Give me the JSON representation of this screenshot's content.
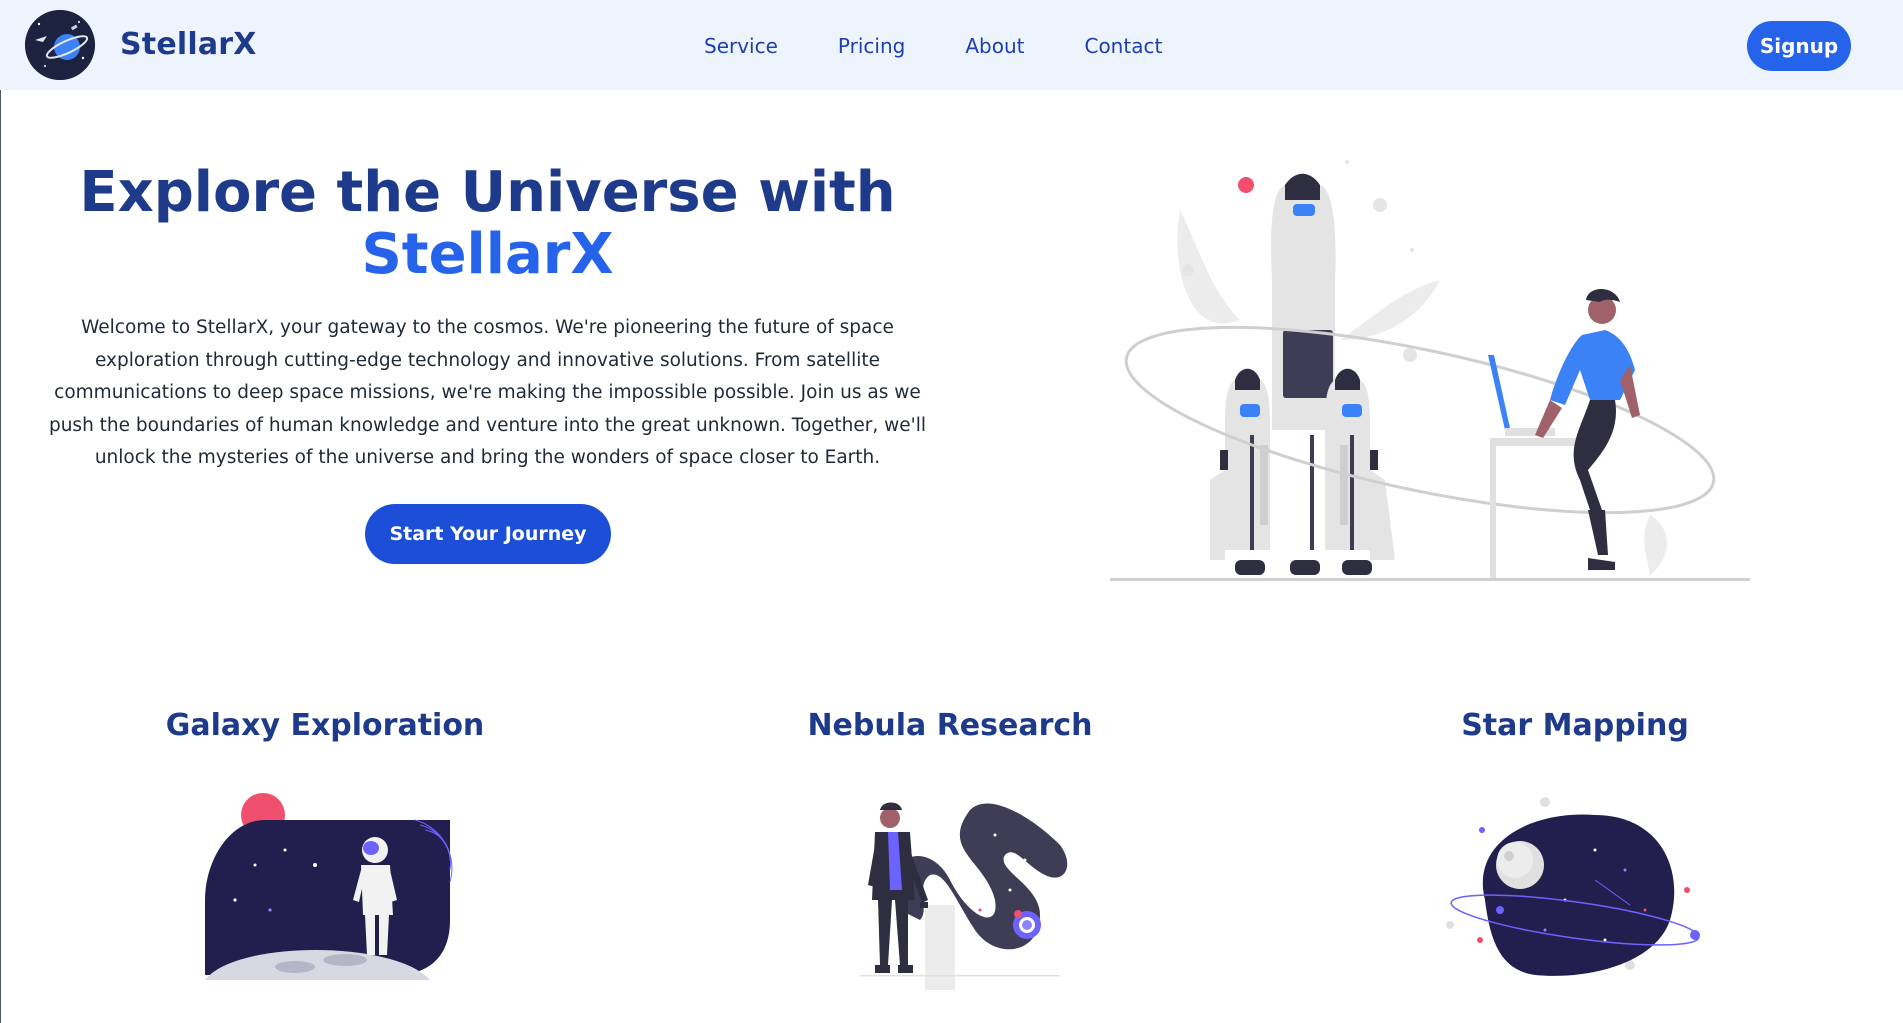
{
  "header": {
    "brand": "StellarX",
    "nav": [
      {
        "label": "Service"
      },
      {
        "label": "Pricing"
      },
      {
        "label": "About"
      },
      {
        "label": "Contact"
      }
    ],
    "signup_label": "Signup"
  },
  "hero": {
    "title_line1": "Explore the Universe with",
    "title_line2": "StellarX",
    "text": "Welcome to StellarX, your gateway to the cosmos. We're pioneering the future of space exploration through cutting-edge technology and innovative solutions. From satellite communications to deep space missions, we're making the impossible possible. Join us as we push the boundaries of human knowledge and venture into the great unknown. Together, we'll unlock the mysteries of the universe and bring the wonders of space closer to Earth.",
    "cta_label": "Start Your Journey"
  },
  "features": [
    {
      "title": "Galaxy Exploration"
    },
    {
      "title": "Nebula Research"
    },
    {
      "title": "Star Mapping"
    }
  ],
  "colors": {
    "primary": "#2563eb",
    "navy": "#1e3a8a",
    "header_bg": "#eef4fe",
    "illus_dark": "#2f2e41",
    "illus_space": "#1e1b4b",
    "illus_pink": "#f0506e"
  }
}
